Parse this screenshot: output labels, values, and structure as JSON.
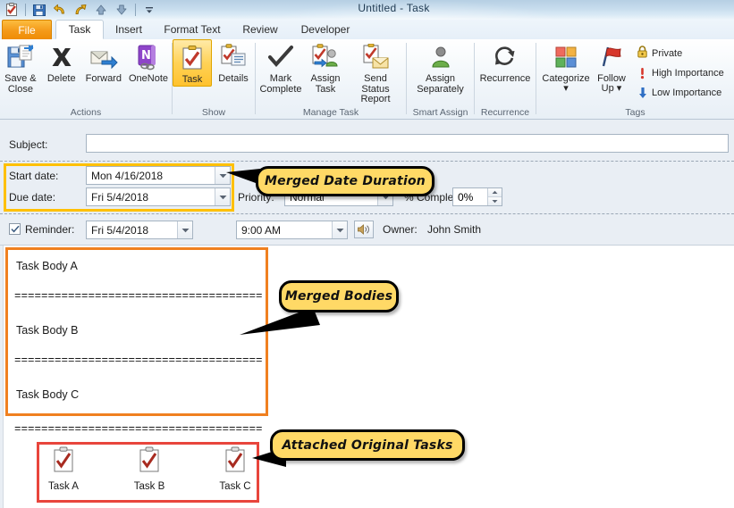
{
  "window": {
    "title": "Untitled  -  Task",
    "quick_access": [
      {
        "name": "task-icon",
        "glyph": "clipboard-check"
      },
      {
        "name": "save-icon",
        "glyph": "floppy"
      },
      {
        "name": "undo-icon",
        "glyph": "undo"
      },
      {
        "name": "redo-icon",
        "glyph": "redo"
      },
      {
        "name": "previous-item-icon",
        "glyph": "up"
      },
      {
        "name": "next-item-icon",
        "glyph": "down"
      },
      {
        "name": "customize-quick-access-icon",
        "glyph": "chevron-down"
      }
    ]
  },
  "tabs": [
    {
      "label": "File",
      "kind": "file"
    },
    {
      "label": "Task",
      "kind": "active"
    },
    {
      "label": "Insert",
      "kind": "normal"
    },
    {
      "label": "Format Text",
      "kind": "normal"
    },
    {
      "label": "Review",
      "kind": "normal"
    },
    {
      "label": "Developer",
      "kind": "normal"
    }
  ],
  "ribbon": {
    "groups": [
      {
        "name": "actions",
        "label": "Actions",
        "buttons": [
          {
            "label": "Save &\nClose",
            "icon": "save-and-close-icon"
          },
          {
            "label": "Delete",
            "icon": "delete-icon"
          },
          {
            "label": "Forward",
            "icon": "forward-icon"
          },
          {
            "label": "OneNote",
            "icon": "onenote-icon"
          }
        ]
      },
      {
        "name": "show",
        "label": "Show",
        "buttons": [
          {
            "label": "Task",
            "icon": "task-view-icon",
            "selected": true
          },
          {
            "label": "Details",
            "icon": "details-view-icon",
            "selected": false
          }
        ]
      },
      {
        "name": "manage-task",
        "label": "Manage Task",
        "buttons": [
          {
            "label": "Mark\nComplete",
            "icon": "mark-complete-icon"
          },
          {
            "label": "Assign\nTask",
            "icon": "assign-task-icon"
          },
          {
            "label": "Send Status\nReport",
            "icon": "send-status-report-icon"
          }
        ]
      },
      {
        "name": "smart-assign",
        "label": "Smart Assign",
        "buttons": [
          {
            "label": "Assign\nSeparately",
            "icon": "assign-separately-icon"
          }
        ]
      },
      {
        "name": "recurrence",
        "label": "Recurrence",
        "buttons": [
          {
            "label": "Recurrence",
            "icon": "recurrence-icon"
          }
        ]
      },
      {
        "name": "tags",
        "label": "Tags",
        "buttons": [
          {
            "label": "Categorize\n▾",
            "icon": "categorize-icon"
          },
          {
            "label": "Follow\nUp ▾",
            "icon": "follow-up-icon"
          }
        ],
        "small_buttons": [
          {
            "label": "Private",
            "icon": "lock-icon"
          },
          {
            "label": "High Importance",
            "icon": "exclamation-icon"
          },
          {
            "label": "Low Importance",
            "icon": "down-arrow-icon"
          }
        ]
      }
    ]
  },
  "form": {
    "subject_label": "Subject:",
    "subject_value": "",
    "start_date_label": "Start date:",
    "start_date_value": "Mon 4/16/2018",
    "due_date_label": "Due date:",
    "due_date_value": "Fri 5/4/2018",
    "priority_label": "Priority:",
    "priority_value": "Normal",
    "percent_complete_label": "% Complete:",
    "percent_complete_value": "0%",
    "reminder_label": "Reminder:",
    "reminder_checked": true,
    "reminder_date_value": "Fri 5/4/2018",
    "reminder_time_value": "9:00 AM",
    "sound_icon": "sound-icon",
    "owner_label": "Owner:",
    "owner_value": "John Smith"
  },
  "notes": {
    "lines": [
      "Task Body A",
      "Task Body B",
      "Task Body C"
    ],
    "separator": "=====================================",
    "attachments": [
      {
        "name": "Task A",
        "icon": "task-attachment-icon"
      },
      {
        "name": "Task B",
        "icon": "task-attachment-icon"
      },
      {
        "name": "Task C",
        "icon": "task-attachment-icon"
      }
    ]
  },
  "annotations": [
    {
      "name": "merged-date-duration",
      "text": "Merged Date Duration",
      "box_color": "#ffc000"
    },
    {
      "name": "merged-bodies",
      "text": "Merged Bodies",
      "box_color": "#f08020"
    },
    {
      "name": "attached-original-tasks",
      "text": "Attached Original Tasks",
      "box_color": "#e8453c"
    }
  ],
  "colors": {
    "callout_fill": "#ffd966",
    "callout_border": "#000000",
    "gold": "#ffc000",
    "orange": "#f08020",
    "red": "#e8453c",
    "file_tab": "#f49a19"
  }
}
